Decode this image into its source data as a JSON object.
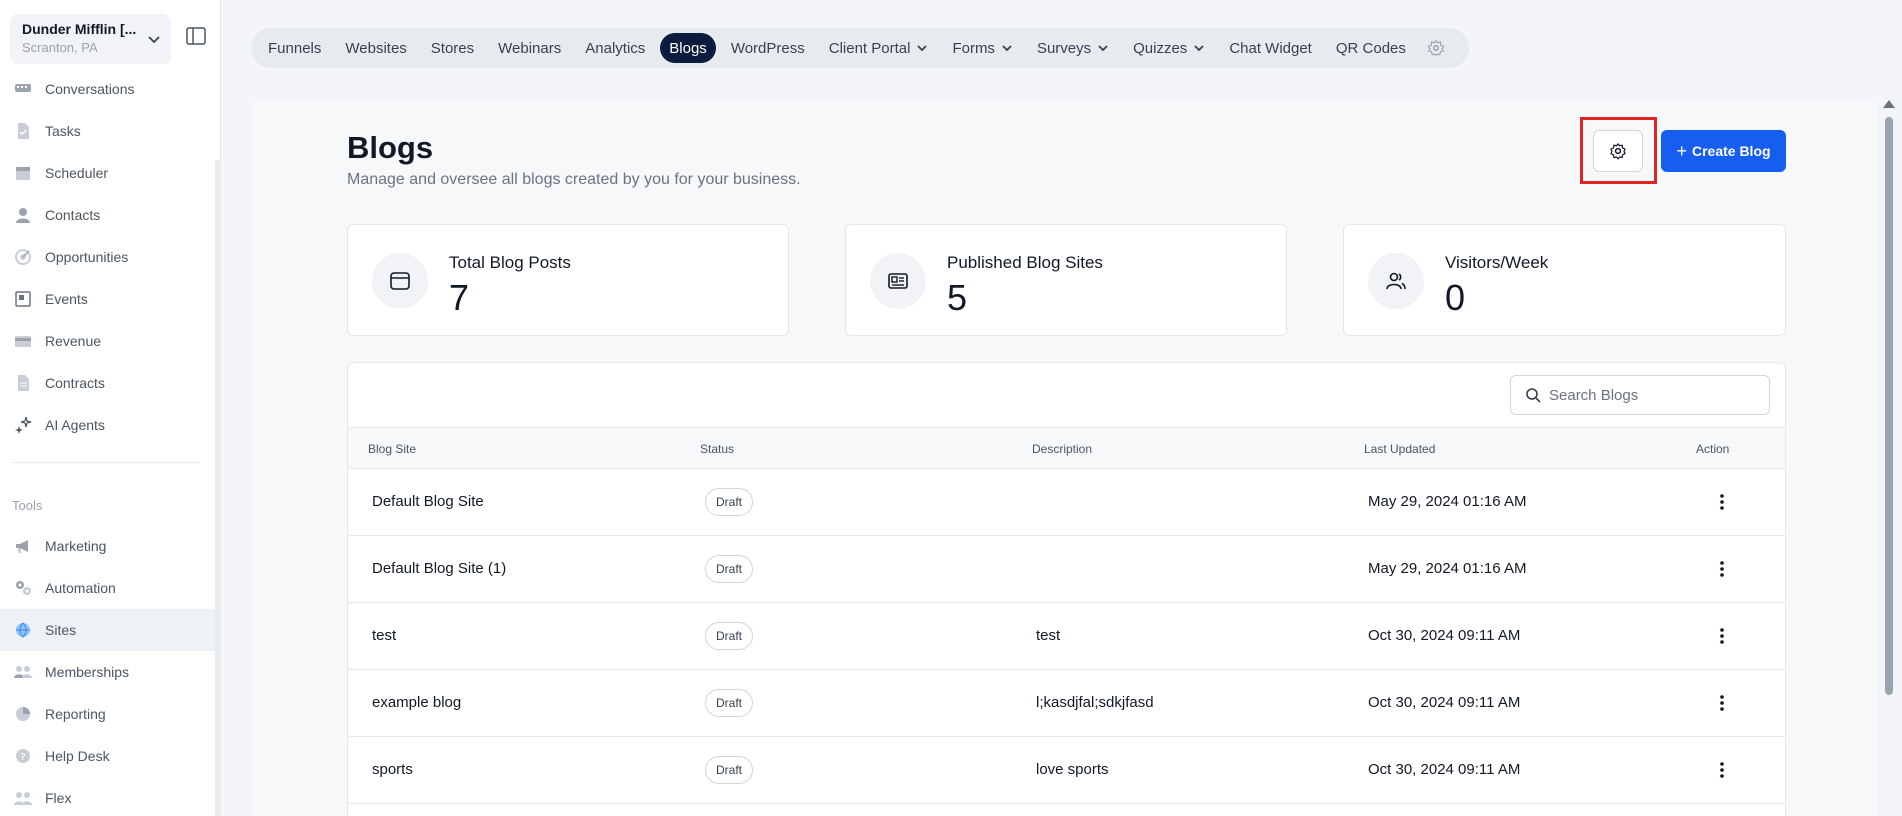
{
  "account": {
    "name": "Dunder Mifflin [...",
    "location": "Scranton, PA"
  },
  "sidebar": {
    "items": [
      {
        "label": "Conversations",
        "icon": "chat-icon"
      },
      {
        "label": "Tasks",
        "icon": "tasks-icon"
      },
      {
        "label": "Scheduler",
        "icon": "calendar-icon"
      },
      {
        "label": "Contacts",
        "icon": "person-icon"
      },
      {
        "label": "Opportunities",
        "icon": "target-icon"
      },
      {
        "label": "Events",
        "icon": "events-icon"
      },
      {
        "label": "Revenue",
        "icon": "card-icon"
      },
      {
        "label": "Contracts",
        "icon": "document-icon"
      },
      {
        "label": "AI Agents",
        "icon": "sparkle-icon"
      }
    ],
    "tools_label": "Tools",
    "tools": [
      {
        "label": "Marketing",
        "icon": "megaphone-icon"
      },
      {
        "label": "Automation",
        "icon": "gears-icon"
      },
      {
        "label": "Sites",
        "icon": "globe-icon",
        "active": true
      },
      {
        "label": "Memberships",
        "icon": "members-icon"
      },
      {
        "label": "Reporting",
        "icon": "chart-icon"
      },
      {
        "label": "Help Desk",
        "icon": "help-icon"
      },
      {
        "label": "Flex",
        "icon": "flex-icon"
      }
    ]
  },
  "tabs": [
    {
      "label": "Funnels"
    },
    {
      "label": "Websites"
    },
    {
      "label": "Stores"
    },
    {
      "label": "Webinars"
    },
    {
      "label": "Analytics"
    },
    {
      "label": "Blogs",
      "active": true
    },
    {
      "label": "WordPress"
    },
    {
      "label": "Client Portal",
      "dropdown": true
    },
    {
      "label": "Forms",
      "dropdown": true
    },
    {
      "label": "Surveys",
      "dropdown": true
    },
    {
      "label": "Quizzes",
      "dropdown": true
    },
    {
      "label": "Chat Widget"
    },
    {
      "label": "QR Codes"
    }
  ],
  "page": {
    "title": "Blogs",
    "subtitle": "Manage and oversee all blogs created by you for your business.",
    "create_label": "Create Blog"
  },
  "stats": [
    {
      "label": "Total Blog Posts",
      "value": "7",
      "icon": "browser-icon"
    },
    {
      "label": "Published Blog Sites",
      "value": "5",
      "icon": "article-icon"
    },
    {
      "label": "Visitors/Week",
      "value": "0",
      "icon": "users-icon"
    }
  ],
  "search": {
    "placeholder": "Search Blogs"
  },
  "table": {
    "headers": [
      "Blog Site",
      "Status",
      "Description",
      "Last Updated",
      "Action"
    ],
    "rows": [
      {
        "name": "Default Blog Site",
        "status": "Draft",
        "description": "",
        "updated": "May 29, 2024 01:16 AM"
      },
      {
        "name": "Default Blog Site (1)",
        "status": "Draft",
        "description": "",
        "updated": "May 29, 2024 01:16 AM"
      },
      {
        "name": "test",
        "status": "Draft",
        "description": "test",
        "updated": "Oct 30, 2024 09:11 AM"
      },
      {
        "name": "example blog",
        "status": "Draft",
        "description": "l;kasdjfal;sdkjfasd",
        "updated": "Oct 30, 2024 09:11 AM"
      },
      {
        "name": "sports",
        "status": "Draft",
        "description": "love sports",
        "updated": "Oct 30, 2024 09:11 AM"
      }
    ]
  },
  "colors": {
    "accent": "#155eef",
    "active_tab": "#0d1b3e",
    "highlight": "#e02424"
  }
}
